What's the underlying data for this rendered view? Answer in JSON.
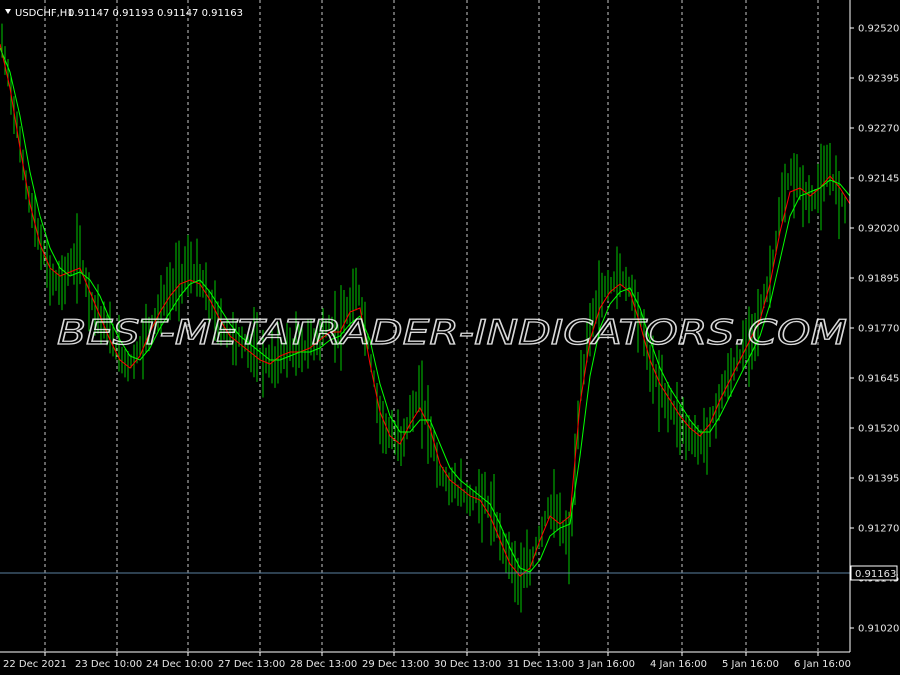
{
  "header": {
    "symbol": "USDCHF,H1",
    "values": "0.91147 0.91193 0.91147 0.91163"
  },
  "watermark": "BEST-METATRADER-INDICATORS.COM",
  "colors": {
    "background": "#000000",
    "candles": "#00c800",
    "ma_fast": "#ff0000",
    "ma_slow": "#00ff00",
    "grid": "#c8c8c8",
    "axis": "#ffffff",
    "hline": "#5a7fa0"
  },
  "chart_data": {
    "type": "bar",
    "ylim": [
      0.9096,
      0.9259
    ],
    "y_ticks": [
      "0.92520",
      "0.92395",
      "0.92270",
      "0.92145",
      "0.92020",
      "0.91895",
      "0.91770",
      "0.91645",
      "0.91520",
      "0.91395",
      "0.91270",
      "0.91145",
      "0.91020"
    ],
    "x_labels": [
      "22 Dec 2021",
      "23 Dec 10:00",
      "24 Dec 10:00",
      "27 Dec 13:00",
      "28 Dec 13:00",
      "29 Dec 13:00",
      "30 Dec 13:00",
      "31 Dec 13:00",
      "3 Jan 16:00",
      "4 Jan 16:00",
      "5 Jan 16:00",
      "6 Jan 16:00"
    ],
    "current_price": "0.91163",
    "series": [
      {
        "name": "",
        "role": "price",
        "x": [
          0,
          10,
          20,
          30,
          40,
          50,
          60,
          70,
          80,
          90,
          100,
          110,
          120,
          130,
          140,
          150,
          160,
          170,
          180,
          190,
          200,
          210,
          220,
          230,
          240,
          250,
          260,
          270,
          280,
          290,
          300,
          310,
          320,
          330,
          340,
          350,
          360,
          370,
          380,
          390,
          400,
          410,
          420,
          430,
          440,
          450,
          460,
          470,
          480,
          490,
          500,
          510,
          520,
          530,
          540,
          550,
          560,
          570,
          580,
          590,
          600,
          610,
          620,
          630,
          640,
          650,
          660,
          670,
          680,
          690,
          700,
          710,
          720,
          730,
          740,
          750,
          760,
          770,
          780,
          790,
          800,
          810,
          820,
          830,
          840,
          850
        ],
        "y": [
          0.925,
          0.9238,
          0.9222,
          0.9208,
          0.9198,
          0.919,
          0.9188,
          0.9192,
          0.9195,
          0.9185,
          0.918,
          0.9175,
          0.917,
          0.9168,
          0.9172,
          0.9178,
          0.9182,
          0.9186,
          0.919,
          0.9192,
          0.9189,
          0.9183,
          0.9178,
          0.9175,
          0.9174,
          0.9172,
          0.917,
          0.9168,
          0.917,
          0.9172,
          0.9171,
          0.9173,
          0.9175,
          0.9178,
          0.9176,
          0.9182,
          0.9186,
          0.917,
          0.9155,
          0.915,
          0.9148,
          0.9155,
          0.916,
          0.9152,
          0.914,
          0.9138,
          0.9136,
          0.9134,
          0.9135,
          0.9132,
          0.9125,
          0.912,
          0.9114,
          0.9117,
          0.9126,
          0.9133,
          0.9128,
          0.9122,
          0.916,
          0.9178,
          0.9185,
          0.9188,
          0.919,
          0.9188,
          0.918,
          0.9168,
          0.9162,
          0.9158,
          0.9154,
          0.915,
          0.9148,
          0.9152,
          0.916,
          0.9165,
          0.917,
          0.9175,
          0.918,
          0.919,
          0.9205,
          0.9215,
          0.9213,
          0.9208,
          0.9212,
          0.9216,
          0.921,
          0.9205
        ]
      },
      {
        "name": "",
        "role": "ma_fast",
        "x": [
          0,
          10,
          20,
          30,
          40,
          50,
          60,
          70,
          80,
          90,
          100,
          110,
          120,
          130,
          140,
          150,
          160,
          170,
          180,
          190,
          200,
          210,
          220,
          230,
          240,
          250,
          260,
          270,
          280,
          290,
          300,
          310,
          320,
          330,
          340,
          350,
          360,
          370,
          380,
          390,
          400,
          410,
          420,
          430,
          440,
          450,
          460,
          470,
          480,
          490,
          500,
          510,
          520,
          530,
          540,
          550,
          560,
          570,
          580,
          590,
          600,
          610,
          620,
          630,
          640,
          650,
          660,
          670,
          680,
          690,
          700,
          710,
          720,
          730,
          740,
          750,
          760,
          770,
          780,
          790,
          800,
          810,
          820,
          830,
          840,
          850
        ],
        "y": [
          0.9248,
          0.9237,
          0.9222,
          0.9208,
          0.9198,
          0.9192,
          0.919,
          0.9191,
          0.9192,
          0.9186,
          0.918,
          0.9174,
          0.9169,
          0.9167,
          0.917,
          0.9176,
          0.9181,
          0.9185,
          0.9188,
          0.9189,
          0.9188,
          0.9184,
          0.9179,
          0.9175,
          0.9173,
          0.9171,
          0.9169,
          0.9168,
          0.917,
          0.9171,
          0.9171,
          0.9172,
          0.9174,
          0.9176,
          0.9176,
          0.9181,
          0.9182,
          0.9168,
          0.9156,
          0.915,
          0.9148,
          0.9153,
          0.9157,
          0.9152,
          0.9143,
          0.9139,
          0.9137,
          0.9135,
          0.9134,
          0.913,
          0.9124,
          0.9118,
          0.9115,
          0.9117,
          0.9124,
          0.913,
          0.9128,
          0.913,
          0.9158,
          0.9174,
          0.9182,
          0.9186,
          0.9188,
          0.9186,
          0.9178,
          0.9169,
          0.9163,
          0.9159,
          0.9155,
          0.9152,
          0.915,
          0.9153,
          0.9159,
          0.9164,
          0.9169,
          0.9174,
          0.9179,
          0.9188,
          0.9201,
          0.9211,
          0.9212,
          0.921,
          0.9212,
          0.9215,
          0.9212,
          0.9208
        ]
      },
      {
        "name": "",
        "role": "ma_slow",
        "x": [
          0,
          10,
          20,
          30,
          40,
          50,
          60,
          70,
          80,
          90,
          100,
          110,
          120,
          130,
          140,
          150,
          160,
          170,
          180,
          190,
          200,
          210,
          220,
          230,
          240,
          250,
          260,
          270,
          280,
          290,
          300,
          310,
          320,
          330,
          340,
          350,
          360,
          370,
          380,
          390,
          400,
          410,
          420,
          430,
          440,
          450,
          460,
          470,
          480,
          490,
          500,
          510,
          520,
          530,
          540,
          550,
          560,
          570,
          580,
          590,
          600,
          610,
          620,
          630,
          640,
          650,
          660,
          670,
          680,
          690,
          700,
          710,
          720,
          730,
          740,
          750,
          760,
          770,
          780,
          790,
          800,
          810,
          820,
          830,
          840,
          850
        ],
        "y": [
          0.9247,
          0.9241,
          0.923,
          0.9216,
          0.9205,
          0.9197,
          0.9192,
          0.919,
          0.9191,
          0.9189,
          0.9185,
          0.9179,
          0.9174,
          0.917,
          0.9169,
          0.9172,
          0.9177,
          0.9181,
          0.9185,
          0.9188,
          0.9189,
          0.9186,
          0.9182,
          0.9178,
          0.9175,
          0.9173,
          0.9171,
          0.9169,
          0.9169,
          0.917,
          0.9171,
          0.9171,
          0.9172,
          0.9174,
          0.9175,
          0.9178,
          0.918,
          0.9174,
          0.9163,
          0.9155,
          0.9151,
          0.9151,
          0.9154,
          0.9154,
          0.9148,
          0.9142,
          0.9139,
          0.9137,
          0.9135,
          0.9133,
          0.9128,
          0.9122,
          0.9117,
          0.9116,
          0.9119,
          0.9125,
          0.9127,
          0.9128,
          0.9145,
          0.9165,
          0.9177,
          0.9183,
          0.9186,
          0.9187,
          0.9182,
          0.9174,
          0.9167,
          0.9162,
          0.9158,
          0.9154,
          0.9151,
          0.9151,
          0.9155,
          0.916,
          0.9165,
          0.917,
          0.9175,
          0.9183,
          0.9194,
          0.9205,
          0.921,
          0.9211,
          0.9212,
          0.9214,
          0.9213,
          0.921
        ]
      }
    ]
  }
}
